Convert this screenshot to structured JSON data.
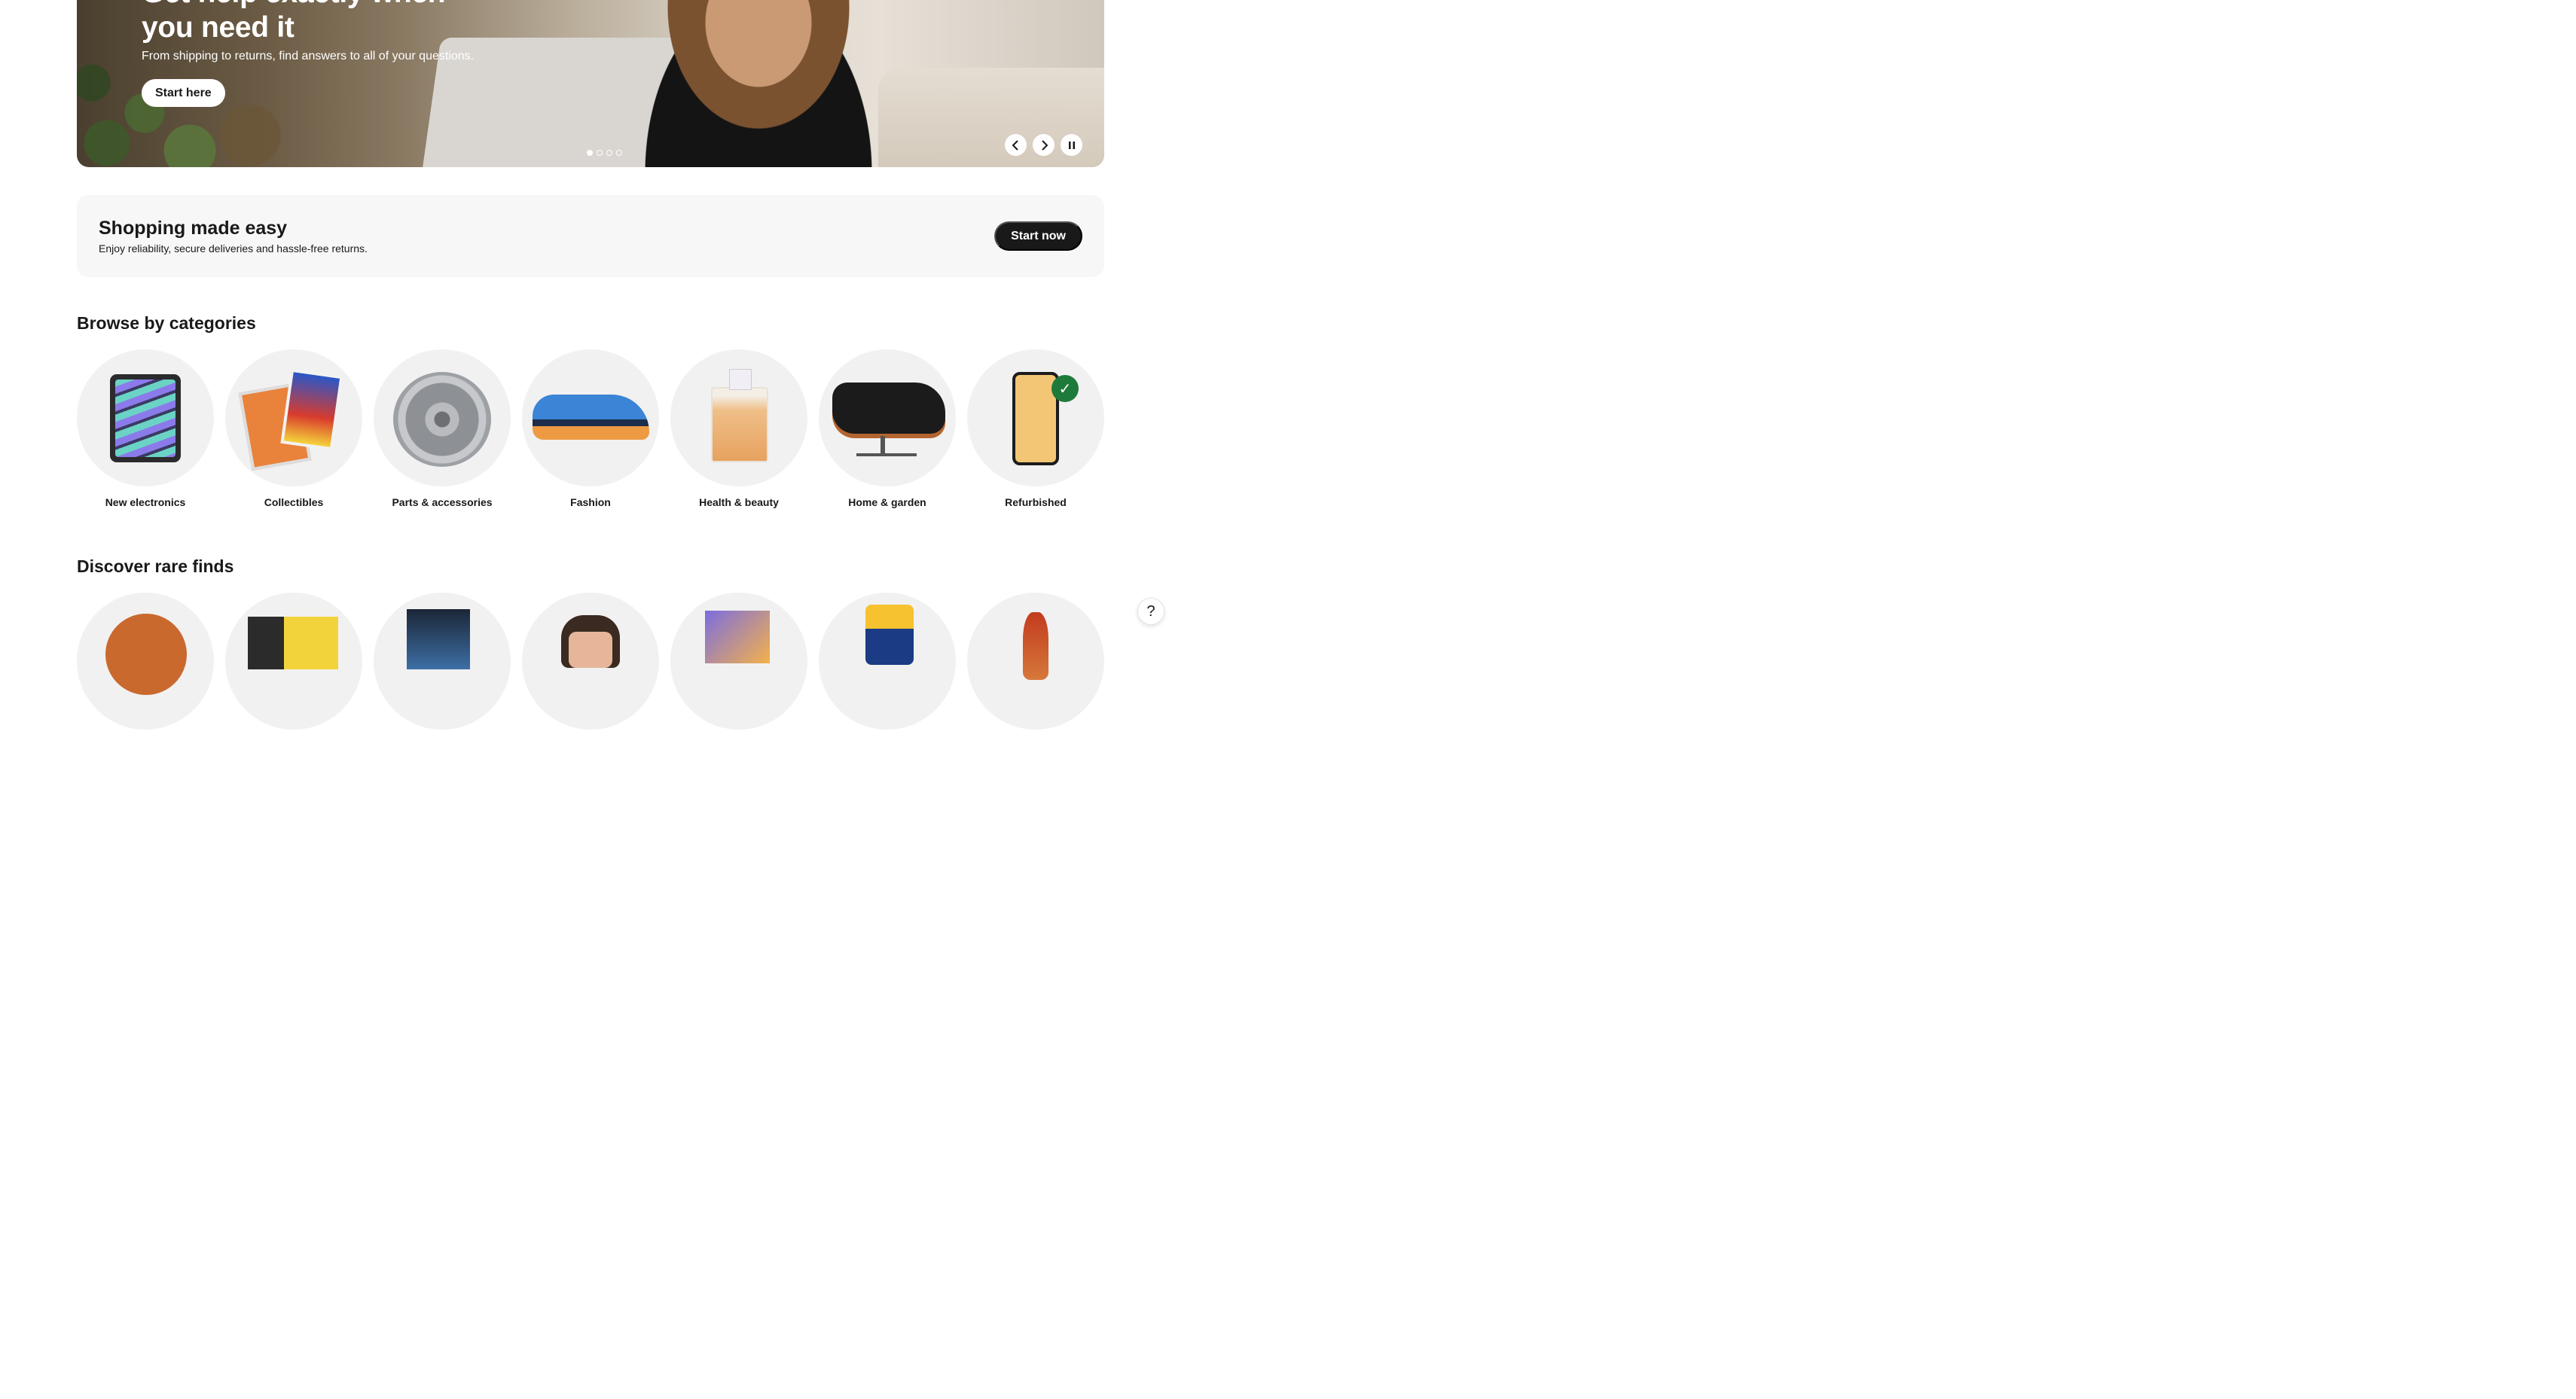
{
  "hero": {
    "title": "Get help exactly when you need it",
    "subtitle": "From shipping to returns, find answers to all of your questions.",
    "cta_label": "Start here",
    "prev_icon": "chevron-left-icon",
    "next_icon": "chevron-right-icon",
    "pause_icon": "pause-icon",
    "slide_count": 4,
    "active_slide": 1
  },
  "banner": {
    "title": "Shopping made easy",
    "subtitle": "Enjoy reliability, secure deliveries and hassle-free returns.",
    "cta_label": "Start now"
  },
  "browse": {
    "title": "Browse by categories",
    "items": [
      {
        "label": "New electronics"
      },
      {
        "label": "Collectibles"
      },
      {
        "label": "Parts & accessories"
      },
      {
        "label": "Fashion"
      },
      {
        "label": "Health & beauty"
      },
      {
        "label": "Home & garden"
      },
      {
        "label": "Refurbished"
      }
    ]
  },
  "discover": {
    "title": "Discover rare finds"
  },
  "help_icon": "question-mark-icon",
  "colors": {
    "primary_dark": "#191919",
    "card_bg": "#f1f1f1",
    "banner_bg": "#f7f7f7",
    "refurbished_badge": "#1e7a3a"
  }
}
